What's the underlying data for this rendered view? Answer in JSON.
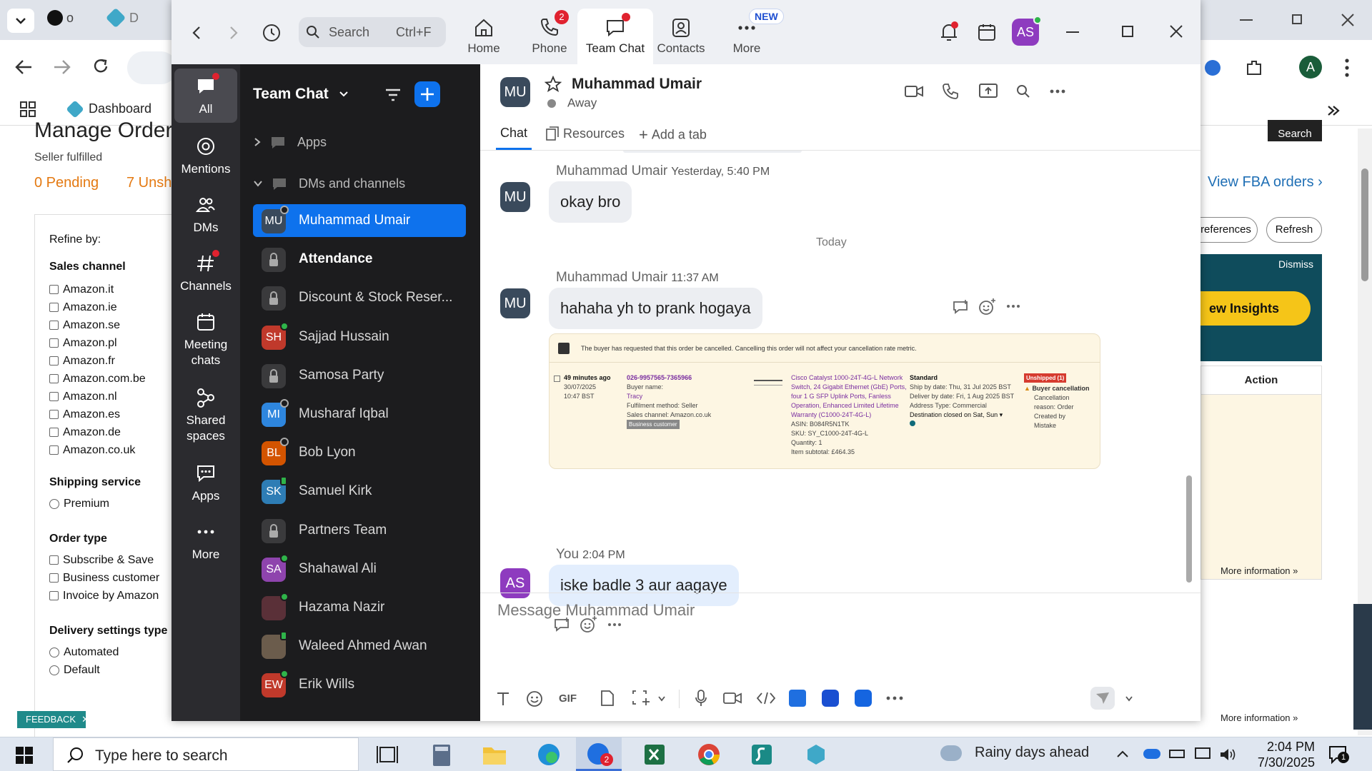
{
  "browser": {
    "tabs": [
      "o",
      "D"
    ],
    "bookmark_label": "Dashboard",
    "page": {
      "title": "Manage Orders",
      "subtitle": "Seller fulfilled",
      "pending": "0 Pending",
      "unshipped": "7 Unsh",
      "view_fba": "View FBA orders",
      "preferences": "references",
      "refresh": "Refresh",
      "dismiss": "Dismiss",
      "insights": "ew Insights",
      "action_header": "Action",
      "more_info": "More information",
      "search_btn": "Search",
      "refine_by": "Refine by:",
      "sales_channel_heading": "Sales channel",
      "sales_channels": [
        "Amazon.it",
        "Amazon.ie",
        "Amazon.se",
        "Amazon.pl",
        "Amazon.fr",
        "Amazon.com.be",
        "Amazon.nl",
        "Amazon.es",
        "Amazon.de",
        "Amazon.co.uk"
      ],
      "shipping_heading": "Shipping service",
      "shipping_options": [
        "Premium"
      ],
      "order_type_heading": "Order type",
      "order_types": [
        "Subscribe & Save",
        "Business customer",
        "Invoice by Amazon"
      ],
      "delivery_heading": "Delivery settings type",
      "delivery_options": [
        "Automated",
        "Default"
      ],
      "feedback": "FEEDBACK"
    },
    "avatar_letter": "A"
  },
  "zoom": {
    "search_label": "Search",
    "search_shortcut": "Ctrl+F",
    "nav_tabs": [
      {
        "label": "Home",
        "icon": "home-icon"
      },
      {
        "label": "Phone",
        "icon": "phone-icon",
        "badge": "2"
      },
      {
        "label": "Team Chat",
        "icon": "chat-icon"
      },
      {
        "label": "Contacts",
        "icon": "contacts-icon"
      },
      {
        "label": "More",
        "icon": "more-icon",
        "badge": "NEW"
      }
    ],
    "user_initials": "AS",
    "rail": [
      {
        "label": "All"
      },
      {
        "label": "Mentions"
      },
      {
        "label": "DMs"
      },
      {
        "label": "Channels"
      },
      {
        "label": "Meeting chats"
      },
      {
        "label": "Shared spaces"
      },
      {
        "label": "Apps"
      },
      {
        "label": "More"
      }
    ],
    "list_title": "Team Chat",
    "apps_label": "Apps",
    "dms_label": "DMs and channels",
    "channels": [
      {
        "name": "Muhammad Umair",
        "initials": "MU",
        "color": "#3a4a5c",
        "status": "away"
      },
      {
        "name": "Attendance",
        "initials": "",
        "color": "#3a3a3c",
        "lock": true,
        "bold": true
      },
      {
        "name": "Discount & Stock Reser...",
        "initials": "",
        "color": "#3a3a3c",
        "lock": true
      },
      {
        "name": "Sajjad Hussain",
        "initials": "SH",
        "color": "#c0392b",
        "status": "online"
      },
      {
        "name": "Samosa Party",
        "initials": "",
        "color": "#3a3a3c",
        "lock": true
      },
      {
        "name": "Musharaf Iqbal",
        "initials": "MI",
        "color": "#2e86de",
        "status": "away"
      },
      {
        "name": "Bob Lyon",
        "initials": "BL",
        "color": "#d35400",
        "status": "away"
      },
      {
        "name": "Samuel Kirk",
        "initials": "SK",
        "color": "#2e7db5",
        "status": "mobile"
      },
      {
        "name": "Partners Team",
        "initials": "",
        "color": "#3a3a3c",
        "lock": true
      },
      {
        "name": "Shahawal Ali",
        "initials": "SA",
        "color": "#8e44ad",
        "status": "online"
      },
      {
        "name": "Hazama Nazir",
        "initials": "",
        "color": "#5a3038",
        "status": "online"
      },
      {
        "name": "Waleed Ahmed Awan",
        "initials": "",
        "color": "#6b5c4c",
        "status": "mobile"
      },
      {
        "name": "Erik Wills",
        "initials": "EW",
        "color": "#c0392b",
        "status": "online"
      }
    ],
    "chat": {
      "header_initials": "MU",
      "contact_name": "Muhammad Umair",
      "contact_status": "Away",
      "tabs": [
        "Chat",
        "Resources",
        "Add a tab"
      ],
      "messages": [
        {
          "sender": "Muhammad Umair",
          "time": "Yesterday, 5:40 PM",
          "text": "okay bro",
          "initials": "MU"
        },
        {
          "sender": "Muhammad Umair",
          "time": "11:37 AM",
          "text": "hahaha yh to prank hogaya",
          "initials": "MU"
        },
        {
          "sender": "You",
          "time": "2:04 PM",
          "text": "iske badle 3 aur aagaye",
          "initials": "AS"
        }
      ],
      "divider": "Today",
      "attachment": {
        "notice": "The buyer has requested that this order be cancelled. Cancelling this order will not affect your cancellation rate metric.",
        "age": "49 minutes ago",
        "date": "30/07/2025",
        "time": "10:47 BST",
        "order_id": "026-9957565-7365966",
        "buyer_label": "Buyer name:",
        "buyer": "Tracy",
        "fulfilment": "Fulfilment method: Seller",
        "sales_channel": "Sales channel: Amazon.co.uk",
        "business": "Business customer",
        "product": "Cisco Catalyst 1000-24T-4G-L Network Switch, 24 Gigabit Ethernet (GbE) Ports, four 1 G SFP Uplink Ports, Fanless Operation, Enhanced Limited Lifetime Warranty (C1000-24T-4G-L)",
        "asin": "ASIN: B084R5N1TK",
        "sku": "SKU: SY_C1000-24T-4G-L",
        "quantity": "Quantity: 1",
        "subtotal": "Item subtotal: £464.35",
        "shipping": "Standard",
        "ship_by": "Ship by date: Thu, 31 Jul 2025 BST",
        "deliver_by": "Deliver by date: Fri, 1 Aug 2025 BST",
        "address_type": "Address Type: Commercial",
        "destination": "Destination closed on Sat, Sun",
        "status_badge": "Unshipped (1)",
        "cancel_title": "Buyer cancellation",
        "cancel_reason": "Cancellation reason: Order Created by Mistake"
      },
      "composer_placeholder": "Message Muhammad Umair"
    }
  },
  "taskbar": {
    "search_placeholder": "Type here to search",
    "weather": "Rainy days ahead",
    "time": "2:04 PM",
    "date": "7/30/2025",
    "notif_count": "1",
    "zoom_badge": "2"
  }
}
